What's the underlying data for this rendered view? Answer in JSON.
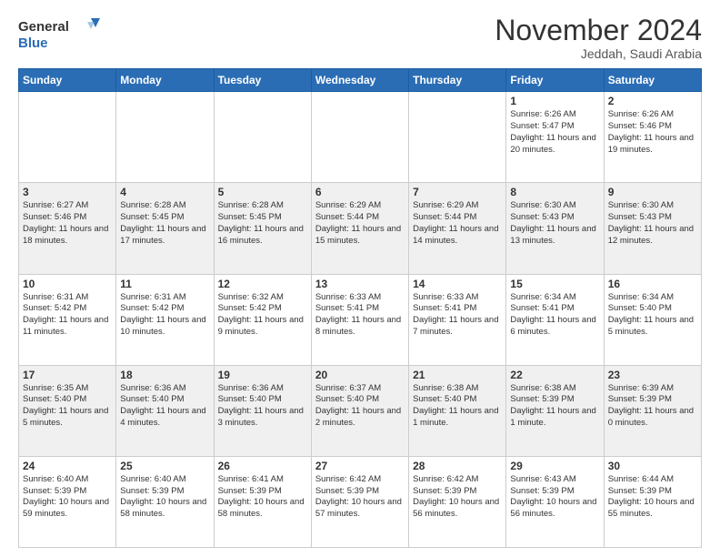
{
  "header": {
    "logo_line1": "General",
    "logo_line2": "Blue",
    "month_title": "November 2024",
    "subtitle": "Jeddah, Saudi Arabia"
  },
  "days_of_week": [
    "Sunday",
    "Monday",
    "Tuesday",
    "Wednesday",
    "Thursday",
    "Friday",
    "Saturday"
  ],
  "weeks": [
    [
      {
        "day": "",
        "info": ""
      },
      {
        "day": "",
        "info": ""
      },
      {
        "day": "",
        "info": ""
      },
      {
        "day": "",
        "info": ""
      },
      {
        "day": "",
        "info": ""
      },
      {
        "day": "1",
        "info": "Sunrise: 6:26 AM\nSunset: 5:47 PM\nDaylight: 11 hours and 20 minutes."
      },
      {
        "day": "2",
        "info": "Sunrise: 6:26 AM\nSunset: 5:46 PM\nDaylight: 11 hours and 19 minutes."
      }
    ],
    [
      {
        "day": "3",
        "info": "Sunrise: 6:27 AM\nSunset: 5:46 PM\nDaylight: 11 hours and 18 minutes."
      },
      {
        "day": "4",
        "info": "Sunrise: 6:28 AM\nSunset: 5:45 PM\nDaylight: 11 hours and 17 minutes."
      },
      {
        "day": "5",
        "info": "Sunrise: 6:28 AM\nSunset: 5:45 PM\nDaylight: 11 hours and 16 minutes."
      },
      {
        "day": "6",
        "info": "Sunrise: 6:29 AM\nSunset: 5:44 PM\nDaylight: 11 hours and 15 minutes."
      },
      {
        "day": "7",
        "info": "Sunrise: 6:29 AM\nSunset: 5:44 PM\nDaylight: 11 hours and 14 minutes."
      },
      {
        "day": "8",
        "info": "Sunrise: 6:30 AM\nSunset: 5:43 PM\nDaylight: 11 hours and 13 minutes."
      },
      {
        "day": "9",
        "info": "Sunrise: 6:30 AM\nSunset: 5:43 PM\nDaylight: 11 hours and 12 minutes."
      }
    ],
    [
      {
        "day": "10",
        "info": "Sunrise: 6:31 AM\nSunset: 5:42 PM\nDaylight: 11 hours and 11 minutes."
      },
      {
        "day": "11",
        "info": "Sunrise: 6:31 AM\nSunset: 5:42 PM\nDaylight: 11 hours and 10 minutes."
      },
      {
        "day": "12",
        "info": "Sunrise: 6:32 AM\nSunset: 5:42 PM\nDaylight: 11 hours and 9 minutes."
      },
      {
        "day": "13",
        "info": "Sunrise: 6:33 AM\nSunset: 5:41 PM\nDaylight: 11 hours and 8 minutes."
      },
      {
        "day": "14",
        "info": "Sunrise: 6:33 AM\nSunset: 5:41 PM\nDaylight: 11 hours and 7 minutes."
      },
      {
        "day": "15",
        "info": "Sunrise: 6:34 AM\nSunset: 5:41 PM\nDaylight: 11 hours and 6 minutes."
      },
      {
        "day": "16",
        "info": "Sunrise: 6:34 AM\nSunset: 5:40 PM\nDaylight: 11 hours and 5 minutes."
      }
    ],
    [
      {
        "day": "17",
        "info": "Sunrise: 6:35 AM\nSunset: 5:40 PM\nDaylight: 11 hours and 5 minutes."
      },
      {
        "day": "18",
        "info": "Sunrise: 6:36 AM\nSunset: 5:40 PM\nDaylight: 11 hours and 4 minutes."
      },
      {
        "day": "19",
        "info": "Sunrise: 6:36 AM\nSunset: 5:40 PM\nDaylight: 11 hours and 3 minutes."
      },
      {
        "day": "20",
        "info": "Sunrise: 6:37 AM\nSunset: 5:40 PM\nDaylight: 11 hours and 2 minutes."
      },
      {
        "day": "21",
        "info": "Sunrise: 6:38 AM\nSunset: 5:40 PM\nDaylight: 11 hours and 1 minute."
      },
      {
        "day": "22",
        "info": "Sunrise: 6:38 AM\nSunset: 5:39 PM\nDaylight: 11 hours and 1 minute."
      },
      {
        "day": "23",
        "info": "Sunrise: 6:39 AM\nSunset: 5:39 PM\nDaylight: 11 hours and 0 minutes."
      }
    ],
    [
      {
        "day": "24",
        "info": "Sunrise: 6:40 AM\nSunset: 5:39 PM\nDaylight: 10 hours and 59 minutes."
      },
      {
        "day": "25",
        "info": "Sunrise: 6:40 AM\nSunset: 5:39 PM\nDaylight: 10 hours and 58 minutes."
      },
      {
        "day": "26",
        "info": "Sunrise: 6:41 AM\nSunset: 5:39 PM\nDaylight: 10 hours and 58 minutes."
      },
      {
        "day": "27",
        "info": "Sunrise: 6:42 AM\nSunset: 5:39 PM\nDaylight: 10 hours and 57 minutes."
      },
      {
        "day": "28",
        "info": "Sunrise: 6:42 AM\nSunset: 5:39 PM\nDaylight: 10 hours and 56 minutes."
      },
      {
        "day": "29",
        "info": "Sunrise: 6:43 AM\nSunset: 5:39 PM\nDaylight: 10 hours and 56 minutes."
      },
      {
        "day": "30",
        "info": "Sunrise: 6:44 AM\nSunset: 5:39 PM\nDaylight: 10 hours and 55 minutes."
      }
    ]
  ]
}
